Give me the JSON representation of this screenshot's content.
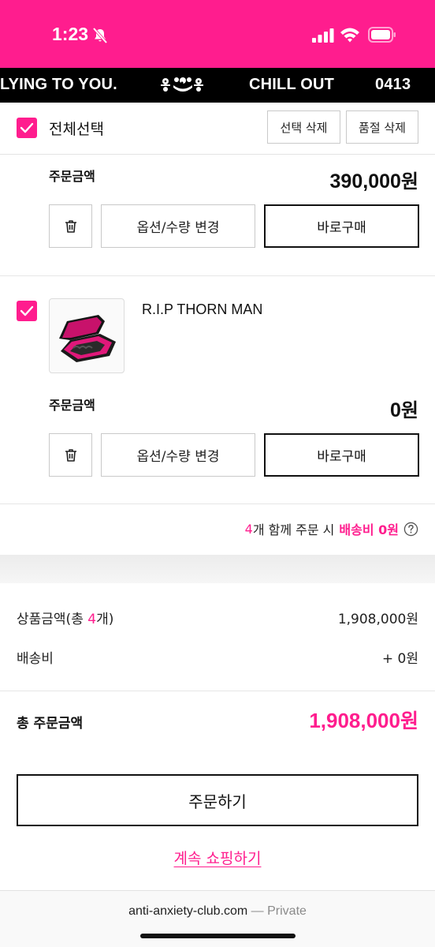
{
  "status_bar": {
    "time": "1:23",
    "accent_color": "#ff1d8e",
    "icons": [
      "bell-slash-icon",
      "cellular-signal-icon",
      "wifi-icon",
      "battery-icon"
    ]
  },
  "marquee": {
    "text_1": "LYING TO YOU.",
    "text_2": "CHILL OUT",
    "text_3": "0413",
    "logo_icon": "brand-logo-icon"
  },
  "select_bar": {
    "select_all_label": "전체선택",
    "delete_selected_label": "선택 삭제",
    "delete_soldout_label": "품절 삭제"
  },
  "items": [
    {
      "order_amount_label": "주문금액",
      "price": "390,000",
      "currency": "원",
      "option_button": "옵션/수량 변경",
      "buy_now_button": "바로구매"
    },
    {
      "product_name": "R.I.P THORN MAN",
      "order_amount_label": "주문금액",
      "price": "0",
      "currency": "원",
      "option_button": "옵션/수량 변경",
      "buy_now_button": "바로구매"
    }
  ],
  "shipping_promo": {
    "count": "4",
    "text_middle": "개 함께 주문 시",
    "highlight": "배송비 0원"
  },
  "summary": {
    "product_amount_label_prefix": "상품금액(총 ",
    "product_count": "4",
    "product_amount_label_suffix": "개)",
    "product_amount_value": "1,908,000원",
    "shipping_label": "배송비",
    "shipping_value": "+ 0원",
    "total_label": "총 주문금액",
    "total_value": "1,908,000",
    "total_currency": "원"
  },
  "actions": {
    "order_button": "주문하기",
    "continue_shopping": "계속 쇼핑하기"
  },
  "address_bar": {
    "domain": "anti-anxiety-club.com",
    "separator": " — ",
    "mode": "Private"
  }
}
